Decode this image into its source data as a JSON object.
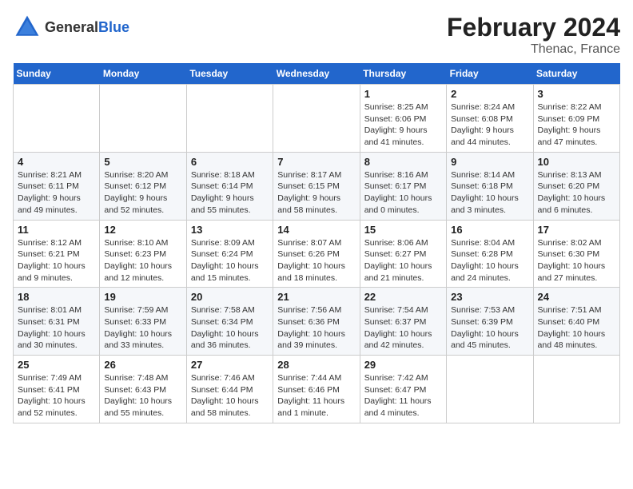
{
  "header": {
    "month_title": "February 2024",
    "location": "Thenac, France",
    "logo_general": "General",
    "logo_blue": "Blue"
  },
  "days_of_week": [
    "Sunday",
    "Monday",
    "Tuesday",
    "Wednesday",
    "Thursday",
    "Friday",
    "Saturday"
  ],
  "weeks": [
    [
      {
        "day": "",
        "info": ""
      },
      {
        "day": "",
        "info": ""
      },
      {
        "day": "",
        "info": ""
      },
      {
        "day": "",
        "info": ""
      },
      {
        "day": "1",
        "info": "Sunrise: 8:25 AM\nSunset: 6:06 PM\nDaylight: 9 hours\nand 41 minutes."
      },
      {
        "day": "2",
        "info": "Sunrise: 8:24 AM\nSunset: 6:08 PM\nDaylight: 9 hours\nand 44 minutes."
      },
      {
        "day": "3",
        "info": "Sunrise: 8:22 AM\nSunset: 6:09 PM\nDaylight: 9 hours\nand 47 minutes."
      }
    ],
    [
      {
        "day": "4",
        "info": "Sunrise: 8:21 AM\nSunset: 6:11 PM\nDaylight: 9 hours\nand 49 minutes."
      },
      {
        "day": "5",
        "info": "Sunrise: 8:20 AM\nSunset: 6:12 PM\nDaylight: 9 hours\nand 52 minutes."
      },
      {
        "day": "6",
        "info": "Sunrise: 8:18 AM\nSunset: 6:14 PM\nDaylight: 9 hours\nand 55 minutes."
      },
      {
        "day": "7",
        "info": "Sunrise: 8:17 AM\nSunset: 6:15 PM\nDaylight: 9 hours\nand 58 minutes."
      },
      {
        "day": "8",
        "info": "Sunrise: 8:16 AM\nSunset: 6:17 PM\nDaylight: 10 hours\nand 0 minutes."
      },
      {
        "day": "9",
        "info": "Sunrise: 8:14 AM\nSunset: 6:18 PM\nDaylight: 10 hours\nand 3 minutes."
      },
      {
        "day": "10",
        "info": "Sunrise: 8:13 AM\nSunset: 6:20 PM\nDaylight: 10 hours\nand 6 minutes."
      }
    ],
    [
      {
        "day": "11",
        "info": "Sunrise: 8:12 AM\nSunset: 6:21 PM\nDaylight: 10 hours\nand 9 minutes."
      },
      {
        "day": "12",
        "info": "Sunrise: 8:10 AM\nSunset: 6:23 PM\nDaylight: 10 hours\nand 12 minutes."
      },
      {
        "day": "13",
        "info": "Sunrise: 8:09 AM\nSunset: 6:24 PM\nDaylight: 10 hours\nand 15 minutes."
      },
      {
        "day": "14",
        "info": "Sunrise: 8:07 AM\nSunset: 6:26 PM\nDaylight: 10 hours\nand 18 minutes."
      },
      {
        "day": "15",
        "info": "Sunrise: 8:06 AM\nSunset: 6:27 PM\nDaylight: 10 hours\nand 21 minutes."
      },
      {
        "day": "16",
        "info": "Sunrise: 8:04 AM\nSunset: 6:28 PM\nDaylight: 10 hours\nand 24 minutes."
      },
      {
        "day": "17",
        "info": "Sunrise: 8:02 AM\nSunset: 6:30 PM\nDaylight: 10 hours\nand 27 minutes."
      }
    ],
    [
      {
        "day": "18",
        "info": "Sunrise: 8:01 AM\nSunset: 6:31 PM\nDaylight: 10 hours\nand 30 minutes."
      },
      {
        "day": "19",
        "info": "Sunrise: 7:59 AM\nSunset: 6:33 PM\nDaylight: 10 hours\nand 33 minutes."
      },
      {
        "day": "20",
        "info": "Sunrise: 7:58 AM\nSunset: 6:34 PM\nDaylight: 10 hours\nand 36 minutes."
      },
      {
        "day": "21",
        "info": "Sunrise: 7:56 AM\nSunset: 6:36 PM\nDaylight: 10 hours\nand 39 minutes."
      },
      {
        "day": "22",
        "info": "Sunrise: 7:54 AM\nSunset: 6:37 PM\nDaylight: 10 hours\nand 42 minutes."
      },
      {
        "day": "23",
        "info": "Sunrise: 7:53 AM\nSunset: 6:39 PM\nDaylight: 10 hours\nand 45 minutes."
      },
      {
        "day": "24",
        "info": "Sunrise: 7:51 AM\nSunset: 6:40 PM\nDaylight: 10 hours\nand 48 minutes."
      }
    ],
    [
      {
        "day": "25",
        "info": "Sunrise: 7:49 AM\nSunset: 6:41 PM\nDaylight: 10 hours\nand 52 minutes."
      },
      {
        "day": "26",
        "info": "Sunrise: 7:48 AM\nSunset: 6:43 PM\nDaylight: 10 hours\nand 55 minutes."
      },
      {
        "day": "27",
        "info": "Sunrise: 7:46 AM\nSunset: 6:44 PM\nDaylight: 10 hours\nand 58 minutes."
      },
      {
        "day": "28",
        "info": "Sunrise: 7:44 AM\nSunset: 6:46 PM\nDaylight: 11 hours\nand 1 minute."
      },
      {
        "day": "29",
        "info": "Sunrise: 7:42 AM\nSunset: 6:47 PM\nDaylight: 11 hours\nand 4 minutes."
      },
      {
        "day": "",
        "info": ""
      },
      {
        "day": "",
        "info": ""
      }
    ]
  ]
}
